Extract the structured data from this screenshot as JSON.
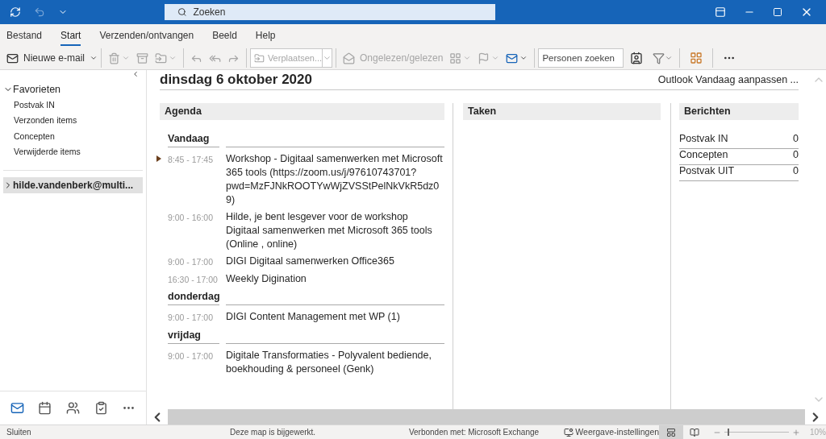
{
  "title_bar": {
    "search_placeholder": "Zoeken"
  },
  "menu_tabs": [
    {
      "label": "Bestand",
      "selected": false
    },
    {
      "label": "Start",
      "selected": true
    },
    {
      "label": "Verzenden/ontvangen",
      "selected": false
    },
    {
      "label": "Beeld",
      "selected": false
    },
    {
      "label": "Help",
      "selected": false
    }
  ],
  "toolbar": {
    "new_mail": "Nieuwe e-mail",
    "delete": {
      "disabled": true
    },
    "archive": {
      "disabled": true
    },
    "move_to": {
      "disabled": true
    },
    "reply": {
      "disabled": true
    },
    "reply_all": {
      "disabled": true
    },
    "forward": {
      "disabled": true
    },
    "move_field": {
      "value": "Verplaatsen...",
      "disabled": true
    },
    "unread_read": {
      "label": "Ongelezen/gelezen",
      "disabled": true
    },
    "categorize": {
      "disabled": true
    },
    "flag": {
      "disabled": true
    },
    "people_search": {
      "placeholder": "Personen zoeken"
    }
  },
  "sidebar": {
    "favorites": {
      "label": "Favorieten",
      "expanded": true,
      "items": [
        "Postvak IN",
        "Verzonden items",
        "Concepten",
        "Verwijderde items"
      ]
    },
    "accounts": [
      {
        "label": "hilde.vandenberk@multi...",
        "expanded": false,
        "selected": true
      }
    ]
  },
  "bottom_nav": [
    {
      "selected": true
    },
    {
      "selected": false
    },
    {
      "selected": false
    },
    {
      "selected": false
    },
    {
      "selected": false
    }
  ],
  "today": {
    "date": "dinsdag 6 oktober 2020",
    "customize": "Outlook Vandaag aanpassen ...",
    "agenda": {
      "title": "Agenda",
      "days": [
        {
          "label": "Vandaag",
          "events": [
            {
              "time": "8:45 - 17:45",
              "title": "Workshop - Digitaal samenwerken met Microsoft 365 tools (https://zoom.us/j/97610743701? pwd=MzFJNkROOTYwWjZVSStPelNkVkR5dz09)",
              "current": true
            },
            {
              "time": "9:00 - 16:00",
              "title": "Hilde, je bent lesgever voor de workshop Digitaal samenwerken met Microsoft 365 tools (Online , online)",
              "current": false
            },
            {
              "time": "9:00 - 17:00",
              "title": "DIGI Digitaal samenwerken Office365",
              "current": false
            },
            {
              "time": "16:30 - 17:00",
              "title": "Weekly Digination",
              "current": false
            }
          ]
        },
        {
          "label": "donderdag",
          "events": [
            {
              "time": "9:00 - 17:00",
              "title": "DIGI Content Management met WP (1)",
              "current": false
            }
          ]
        },
        {
          "label": "vrijdag",
          "events": [
            {
              "time": "9:00 - 17:00",
              "title": "Digitale Transformaties - Polyvalent bediende, boekhouding & personeel (Genk)",
              "current": false
            }
          ]
        }
      ]
    },
    "tasks": {
      "title": "Taken"
    },
    "messages": {
      "title": "Berichten",
      "rows": [
        {
          "folder": "Postvak IN",
          "count": "0"
        },
        {
          "folder": "Concepten",
          "count": "0"
        },
        {
          "folder": "Postvak UIT",
          "count": "0"
        }
      ]
    }
  },
  "status_bar": {
    "left": "Sluiten",
    "center": "Deze map is bijgewerkt.",
    "connection": "Verbonden met: Microsoft Exchange",
    "view_settings": "Weergave-instellingen",
    "views": [
      {
        "selected": true
      },
      {
        "selected": false
      }
    ],
    "zoom": {
      "level": 0.05,
      "reading": "10%"
    }
  }
}
